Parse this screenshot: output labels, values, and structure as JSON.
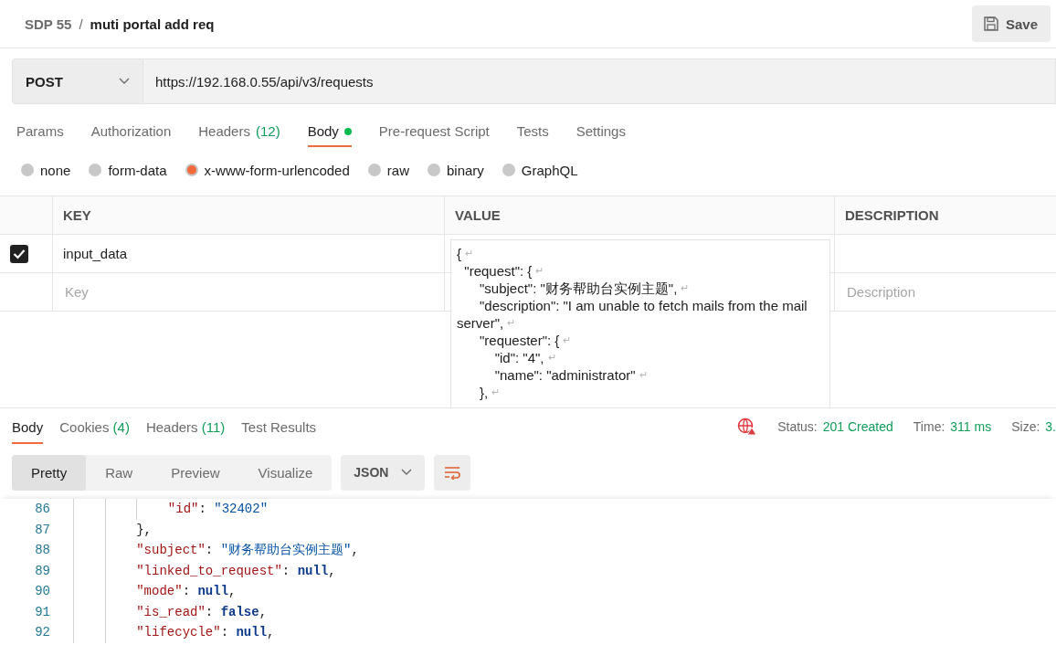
{
  "header": {
    "breadcrumb": "SDP 55",
    "separator": "/",
    "title": "muti portal add req",
    "save_button": "Save"
  },
  "request": {
    "method": "POST",
    "url": "https://192.168.0.55/api/v3/requests"
  },
  "request_tabs": [
    {
      "label": "Params",
      "selected": false
    },
    {
      "label": "Authorization",
      "selected": false
    },
    {
      "label": "Headers",
      "count": "(12)",
      "selected": false
    },
    {
      "label": "Body",
      "selected": true,
      "has_content": true
    },
    {
      "label": "Pre-request Script",
      "selected": false
    },
    {
      "label": "Tests",
      "selected": false
    },
    {
      "label": "Settings",
      "selected": false
    }
  ],
  "body_types": [
    {
      "label": "none",
      "selected": false
    },
    {
      "label": "form-data",
      "selected": false
    },
    {
      "label": "x-www-form-urlencoded",
      "selected": true
    },
    {
      "label": "raw",
      "selected": false
    },
    {
      "label": "binary",
      "selected": false
    },
    {
      "label": "GraphQL",
      "selected": false
    }
  ],
  "params_table": {
    "columns": [
      "KEY",
      "VALUE",
      "DESCRIPTION"
    ],
    "rows": [
      {
        "checked": true,
        "key": "input_data",
        "value_lines": [
          {
            "text": "{",
            "eol": "↵"
          },
          {
            "text": "  \"request\": {",
            "eol": "↵"
          },
          {
            "text": "      \"subject\": \"财务帮助台实例主题\",",
            "eol": "↵"
          },
          {
            "text": "      \"description\": \"I am unable to fetch mails from the mail server\",",
            "eol": "↵"
          },
          {
            "text": "      \"requester\": {",
            "eol": "↵"
          },
          {
            "text": "          \"id\": \"4\",",
            "eol": "↵"
          },
          {
            "text": "          \"name\": \"administrator\"",
            "eol": "↵"
          },
          {
            "text": "      },",
            "eol": "↵"
          }
        ]
      }
    ],
    "new_row": {
      "key_placeholder": "Key",
      "description_placeholder": "Description"
    }
  },
  "response": {
    "tabs": [
      {
        "label": "Body",
        "selected": true
      },
      {
        "label": "Cookies",
        "count": "(4)",
        "selected": false
      },
      {
        "label": "Headers",
        "count": "(11)",
        "selected": false
      },
      {
        "label": "Test Results",
        "selected": false
      }
    ],
    "status_label": "Status:",
    "status": "201 Created",
    "time_label": "Time:",
    "time": "311 ms",
    "size_label": "Size:",
    "size": "3.",
    "view_modes": [
      {
        "label": "Pretty",
        "selected": true
      },
      {
        "label": "Raw",
        "selected": false
      },
      {
        "label": "Preview",
        "selected": false
      },
      {
        "label": "Visualize",
        "selected": false
      }
    ],
    "format": "JSON",
    "code_lines": [
      {
        "number": "86",
        "tokens": [
          {
            "kind": "key",
            "text": "            \"id\""
          },
          {
            "kind": "punct",
            "text": ": "
          },
          {
            "kind": "string",
            "text": "\"32402\""
          }
        ]
      },
      {
        "number": "87",
        "tokens": [
          {
            "kind": "punct",
            "text": "        },"
          }
        ]
      },
      {
        "number": "88",
        "tokens": [
          {
            "kind": "key",
            "text": "        \"subject\""
          },
          {
            "kind": "punct",
            "text": ": "
          },
          {
            "kind": "string",
            "text": "\"财务帮助台实例主题\""
          },
          {
            "kind": "punct",
            "text": ","
          }
        ]
      },
      {
        "number": "89",
        "tokens": [
          {
            "kind": "key",
            "text": "        \"linked_to_request\""
          },
          {
            "kind": "punct",
            "text": ": "
          },
          {
            "kind": "keyword",
            "text": "null"
          },
          {
            "kind": "punct",
            "text": ","
          }
        ]
      },
      {
        "number": "90",
        "tokens": [
          {
            "kind": "key",
            "text": "        \"mode\""
          },
          {
            "kind": "punct",
            "text": ": "
          },
          {
            "kind": "keyword",
            "text": "null"
          },
          {
            "kind": "punct",
            "text": ","
          }
        ]
      },
      {
        "number": "91",
        "tokens": [
          {
            "kind": "key",
            "text": "        \"is_read\""
          },
          {
            "kind": "punct",
            "text": ": "
          },
          {
            "kind": "keyword",
            "text": "false"
          },
          {
            "kind": "punct",
            "text": ","
          }
        ]
      },
      {
        "number": "92",
        "tokens": [
          {
            "kind": "key",
            "text": "        \"lifecycle\""
          },
          {
            "kind": "punct",
            "text": ": "
          },
          {
            "kind": "keyword",
            "text": "null"
          },
          {
            "kind": "punct",
            "text": ","
          }
        ]
      }
    ]
  }
}
